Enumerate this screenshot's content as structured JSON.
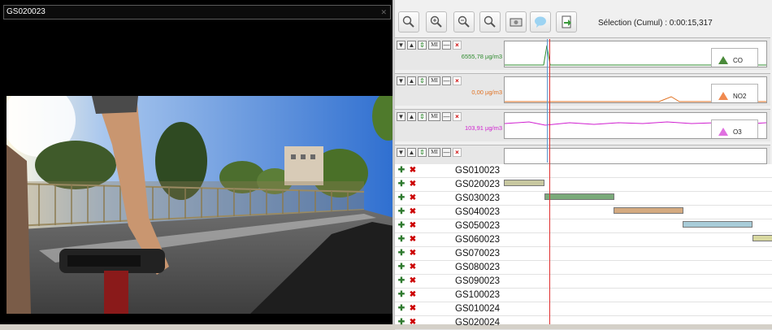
{
  "video": {
    "title": "GS020023"
  },
  "toolbar": {
    "icons": [
      "magnifier-icon",
      "zoom-in-icon",
      "zoom-out-icon",
      "zoom-reset-icon",
      "camera-icon",
      "comment-icon",
      "export-icon"
    ],
    "selection_label": "Sélection (Cumul) : 0:00:15,317"
  },
  "tracks": [
    {
      "value": "6555,78 µg/m3",
      "legend": "CO",
      "color": "#2e8b2e",
      "legend_color": "#4a8a3a"
    },
    {
      "value": "0,00 µg/m3",
      "legend": "NO2",
      "color": "#e07020",
      "legend_color": "#f08a50"
    },
    {
      "value": "103,91 µg/m3",
      "legend": "O3",
      "color": "#d020d0",
      "legend_color": "#e070e0"
    },
    {
      "value": "",
      "legend": "",
      "color": "#333333",
      "legend_color": "#999999"
    }
  ],
  "track_controls": {
    "down": "▼",
    "up": "▲",
    "move": "⇕",
    "mi": "MI",
    "minus": "—",
    "close": "×"
  },
  "files": [
    {
      "name": "GS010023",
      "bar": null
    },
    {
      "name": "GS020023",
      "bar": {
        "color": "#c8c8a0"
      }
    },
    {
      "name": "GS030023",
      "bar": {
        "color": "#7aaa7a"
      }
    },
    {
      "name": "GS040023",
      "bar": {
        "color": "#d4aa80"
      }
    },
    {
      "name": "GS050023",
      "bar": {
        "color": "#a8ccd8"
      }
    },
    {
      "name": "GS060023",
      "bar": {
        "color": "#d8d8a0"
      }
    },
    {
      "name": "GS070023",
      "bar": null
    },
    {
      "name": "GS080023",
      "bar": null
    },
    {
      "name": "GS090023",
      "bar": null
    },
    {
      "name": "GS100023",
      "bar": null
    },
    {
      "name": "GS010024",
      "bar": null
    },
    {
      "name": "GS020024",
      "bar": null
    }
  ],
  "file_controls": {
    "add": "✚",
    "remove": "✖"
  }
}
